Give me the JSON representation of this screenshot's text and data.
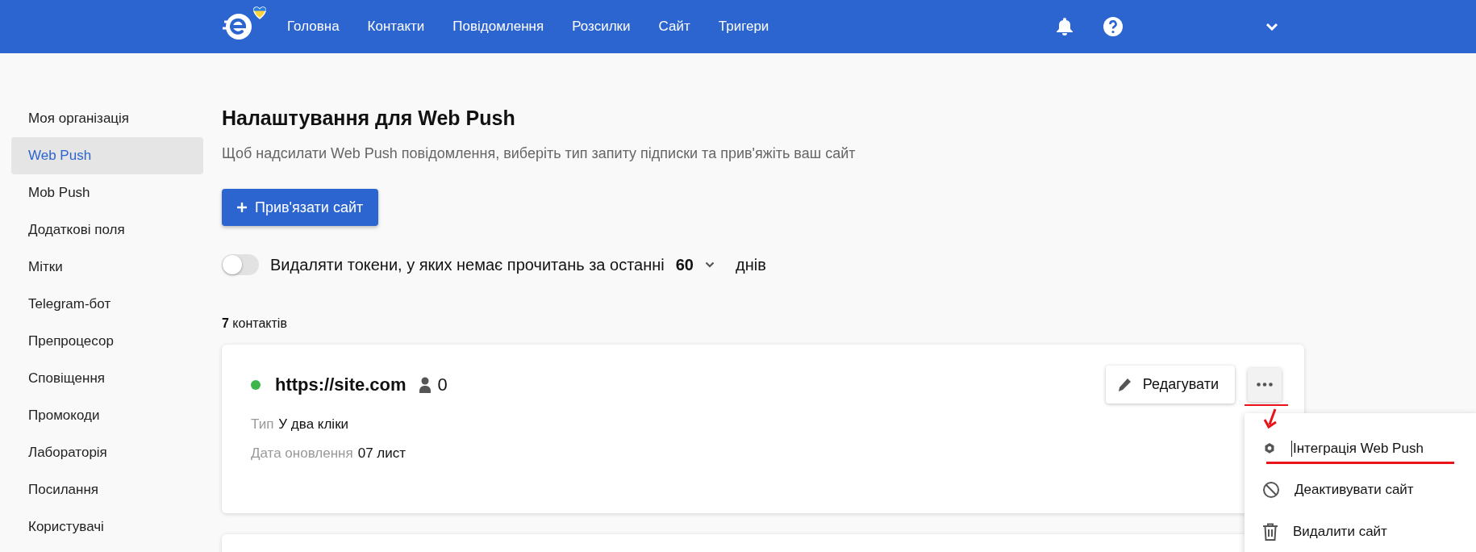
{
  "nav": {
    "items": [
      {
        "label": "Головна"
      },
      {
        "label": "Контакти"
      },
      {
        "label": "Повідомлення"
      },
      {
        "label": "Розсилки"
      },
      {
        "label": "Сайт"
      },
      {
        "label": "Тригери"
      }
    ]
  },
  "sidebar": {
    "items": [
      {
        "label": "Моя організація",
        "selected": false
      },
      {
        "label": "Web Push",
        "selected": true
      },
      {
        "label": "Mob Push",
        "selected": false
      },
      {
        "label": "Додаткові поля",
        "selected": false
      },
      {
        "label": "Мітки",
        "selected": false
      },
      {
        "label": "Telegram-бот",
        "selected": false
      },
      {
        "label": "Препроцесор",
        "selected": false
      },
      {
        "label": "Сповіщення",
        "selected": false
      },
      {
        "label": "Промокоди",
        "selected": false
      },
      {
        "label": "Лабораторія",
        "selected": false
      },
      {
        "label": "Посилання",
        "selected": false
      },
      {
        "label": "Користувачі",
        "selected": false
      }
    ]
  },
  "page": {
    "title": "Налаштування для Web Push",
    "subtitle": "Щоб надсилати Web Push повідомлення, виберіть тип запиту підписки та прив'яжіть ваш сайт",
    "add_button": "Прив'язати сайт",
    "token_cleanup": {
      "on": false,
      "label": "Видаляти токени, у яких немає прочитань за останні",
      "days": "60",
      "unit": "днів"
    },
    "count": "**7** контактів"
  },
  "sites": [
    {
      "url": "https://site.com",
      "color": "#3cb54a",
      "subscribers": "0",
      "type_label": "Тип",
      "type": "У два кліки",
      "date_label": "Дата оновлення",
      "date": "07 лист",
      "edit_button": "Редагувати",
      "menu": {
        "open": true,
        "items": [
          {
            "kind": "gear",
            "label": "Інтеграція Web Push"
          },
          {
            "kind": "block",
            "label": "Деактивувати сайт"
          },
          {
            "kind": "trash",
            "label": "Видалити сайт"
          }
        ]
      }
    }
  ]
}
